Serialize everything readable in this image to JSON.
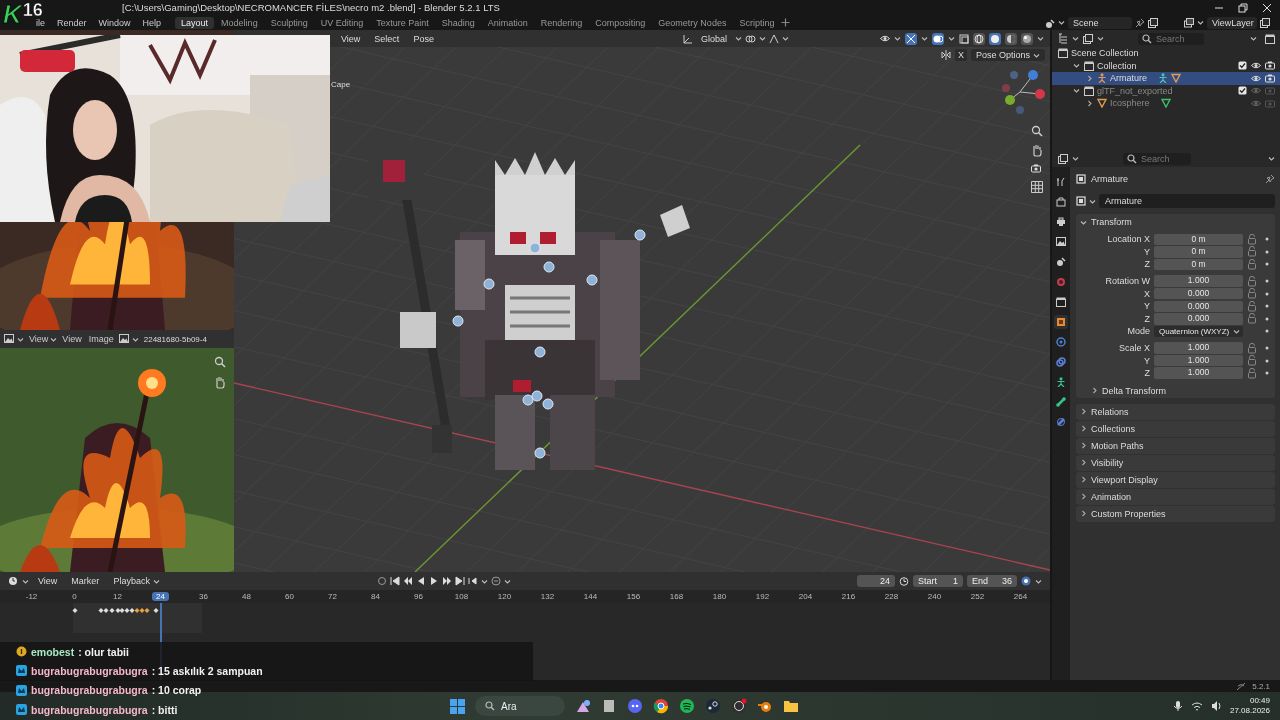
{
  "title_bar": {
    "title": "[C:\\Users\\Gaming\\Desktop\\NECROMANCER FİLES\\necro m2 .blend] - Blender 5.2.1 LTS"
  },
  "stream_logo": {
    "letter": "K",
    "number": "16"
  },
  "menu_bar": {
    "menus": [
      "ile",
      "Render",
      "Window",
      "Help"
    ],
    "workspaces": [
      {
        "label": "Layout",
        "selected": true
      },
      {
        "label": "Modeling",
        "selected": false
      },
      {
        "label": "Sculpting",
        "selected": false
      },
      {
        "label": "UV Editing",
        "selected": false
      },
      {
        "label": "Texture Paint",
        "selected": false
      },
      {
        "label": "Shading",
        "selected": false
      },
      {
        "label": "Animation",
        "selected": false
      },
      {
        "label": "Rendering",
        "selected": false
      },
      {
        "label": "Compositing",
        "selected": false
      },
      {
        "label": "Geometry Nodes",
        "selected": false
      },
      {
        "label": "Scripting",
        "selected": false
      }
    ],
    "scene": "Scene",
    "view_layer": "ViewLayer"
  },
  "image_editor": {
    "menus": [
      {
        "label": "View",
        "kind": "dropdown"
      },
      {
        "label": "View",
        "kind": "menu"
      },
      {
        "label": "Image",
        "kind": "menu"
      }
    ],
    "image_name": "22481680-5b09-4"
  },
  "viewport": {
    "menus": [
      "View",
      "Select",
      "Pose"
    ],
    "orientation": "Global",
    "object_label": "Cape",
    "axis_toggle": "X",
    "pose_options": "Pose Options",
    "shading_modes": [
      {
        "kind": "wireframe",
        "selected": false
      },
      {
        "kind": "solid",
        "selected": true
      },
      {
        "kind": "material",
        "selected": false
      },
      {
        "kind": "rendered",
        "selected": false
      }
    ]
  },
  "outliner": {
    "search_placeholder": "Search",
    "tree": [
      {
        "label": "Scene Collection",
        "kind": "scene_collection",
        "selected": false,
        "visible": true,
        "children": [
          {
            "label": "Collection",
            "kind": "collection",
            "expanded": true,
            "checked": true,
            "selected": false,
            "visible": true,
            "children": [
              {
                "label": "Armature",
                "kind": "armature",
                "expanded": false,
                "selected": true,
                "visible": true
              }
            ]
          },
          {
            "label": "glTF_not_exported",
            "kind": "collection",
            "expanded": true,
            "checked": true,
            "selected": false,
            "visible": false,
            "children": [
              {
                "label": "Icosphere",
                "kind": "mesh",
                "expanded": false,
                "selected": false,
                "visible": false
              }
            ]
          }
        ]
      }
    ]
  },
  "properties": {
    "search_placeholder": "Search",
    "tabs": [
      {
        "kind": "tool",
        "selected": false
      },
      {
        "kind": "render",
        "selected": false
      },
      {
        "kind": "output",
        "selected": false
      },
      {
        "kind": "view_layer",
        "selected": false
      },
      {
        "kind": "scene",
        "selected": false
      },
      {
        "kind": "world",
        "selected": false
      },
      {
        "kind": "collection",
        "selected": false
      },
      {
        "kind": "object",
        "selected": true
      },
      {
        "kind": "physics",
        "selected": false
      },
      {
        "kind": "constraints",
        "selected": false
      },
      {
        "kind": "armature",
        "selected": false
      },
      {
        "kind": "bone",
        "selected": false
      },
      {
        "kind": "bone_constraints",
        "selected": false
      }
    ],
    "object_name": "Armature",
    "data_name": "Armature",
    "panels": [
      {
        "title": "Transform",
        "expanded": true,
        "groups": [
          [
            {
              "label": "Location X",
              "value": "0 m",
              "kind": "number"
            },
            {
              "label": "Y",
              "value": "0 m",
              "kind": "number"
            },
            {
              "label": "Z",
              "value": "0 m",
              "kind": "number"
            }
          ],
          [
            {
              "label": "Rotation W",
              "value": "1.000",
              "kind": "number"
            },
            {
              "label": "X",
              "value": "0.000",
              "kind": "number"
            },
            {
              "label": "Y",
              "value": "0.000",
              "kind": "number"
            },
            {
              "label": "Z",
              "value": "0.000",
              "kind": "number"
            },
            {
              "label": "Mode",
              "value": "Quaternion (WXYZ)",
              "kind": "dropdown"
            }
          ],
          [
            {
              "label": "Scale X",
              "value": "1.000",
              "kind": "number"
            },
            {
              "label": "Y",
              "value": "1.000",
              "kind": "number"
            },
            {
              "label": "Z",
              "value": "1.000",
              "kind": "number"
            }
          ]
        ],
        "subpanels": [
          {
            "title": "Delta Transform",
            "expanded": false
          }
        ]
      },
      {
        "title": "Relations",
        "expanded": false
      },
      {
        "title": "Collections",
        "expanded": false
      },
      {
        "title": "Motion Paths",
        "expanded": false
      },
      {
        "title": "Visibility",
        "expanded": false
      },
      {
        "title": "Viewport Display",
        "expanded": false
      },
      {
        "title": "Animation",
        "expanded": false
      },
      {
        "title": "Custom Properties",
        "expanded": false
      }
    ]
  },
  "timeline": {
    "menus": [
      {
        "label": "View",
        "kind": "menu"
      },
      {
        "label": "Marker",
        "kind": "menu"
      },
      {
        "label": "Playback",
        "kind": "dropdown"
      }
    ],
    "current_frame": "24",
    "start_label": "Start",
    "start": "1",
    "end_label": "End",
    "end": "36",
    "ruler": [
      {
        "label": "-12",
        "current": false
      },
      {
        "label": "0",
        "current": false
      },
      {
        "label": "12",
        "current": false
      },
      {
        "label": "24",
        "current": true
      },
      {
        "label": "36",
        "current": false
      },
      {
        "label": "48",
        "current": false
      },
      {
        "label": "60",
        "current": false
      },
      {
        "label": "72",
        "current": false
      },
      {
        "label": "84",
        "current": false
      },
      {
        "label": "96",
        "current": false
      },
      {
        "label": "108",
        "current": false
      },
      {
        "label": "120",
        "current": false
      },
      {
        "label": "132",
        "current": false
      },
      {
        "label": "144",
        "current": false
      },
      {
        "label": "156",
        "current": false
      },
      {
        "label": "168",
        "current": false
      },
      {
        "label": "180",
        "current": false
      },
      {
        "label": "192",
        "current": false
      },
      {
        "label": "204",
        "current": false
      },
      {
        "label": "216",
        "current": false
      },
      {
        "label": "228",
        "current": false
      },
      {
        "label": "240",
        "current": false
      },
      {
        "label": "252",
        "current": false
      },
      {
        "label": "264",
        "current": false
      }
    ]
  },
  "chat": [
    {
      "user": "emobest",
      "message": ": olur tabii",
      "kind": "coin",
      "color": "#a8e8c4"
    },
    {
      "user": "bugrabugrabugrabugra",
      "message": ": 15 askılık 2 sampuan",
      "kind": "prime",
      "color": "#f5b8cc"
    },
    {
      "user": "bugrabugrabugrabugra",
      "message": ": 10 corap",
      "kind": "prime",
      "color": "#f5b8cc"
    },
    {
      "user": "bugrabugrabugrabugra",
      "message": ": bitti",
      "kind": "prime",
      "color": "#f5b8cc"
    }
  ],
  "status_bar": {
    "version": "5.2.1"
  },
  "taskbar": {
    "search_placeholder": "Ara",
    "apps": [
      {
        "kind": "widget"
      },
      {
        "kind": "files"
      },
      {
        "kind": "chat"
      },
      {
        "kind": "browser"
      },
      {
        "kind": "music"
      },
      {
        "kind": "games"
      },
      {
        "kind": "recorder"
      },
      {
        "kind": "blender"
      },
      {
        "kind": "folder"
      }
    ],
    "time": "00:49",
    "date": "27.08.2026"
  }
}
